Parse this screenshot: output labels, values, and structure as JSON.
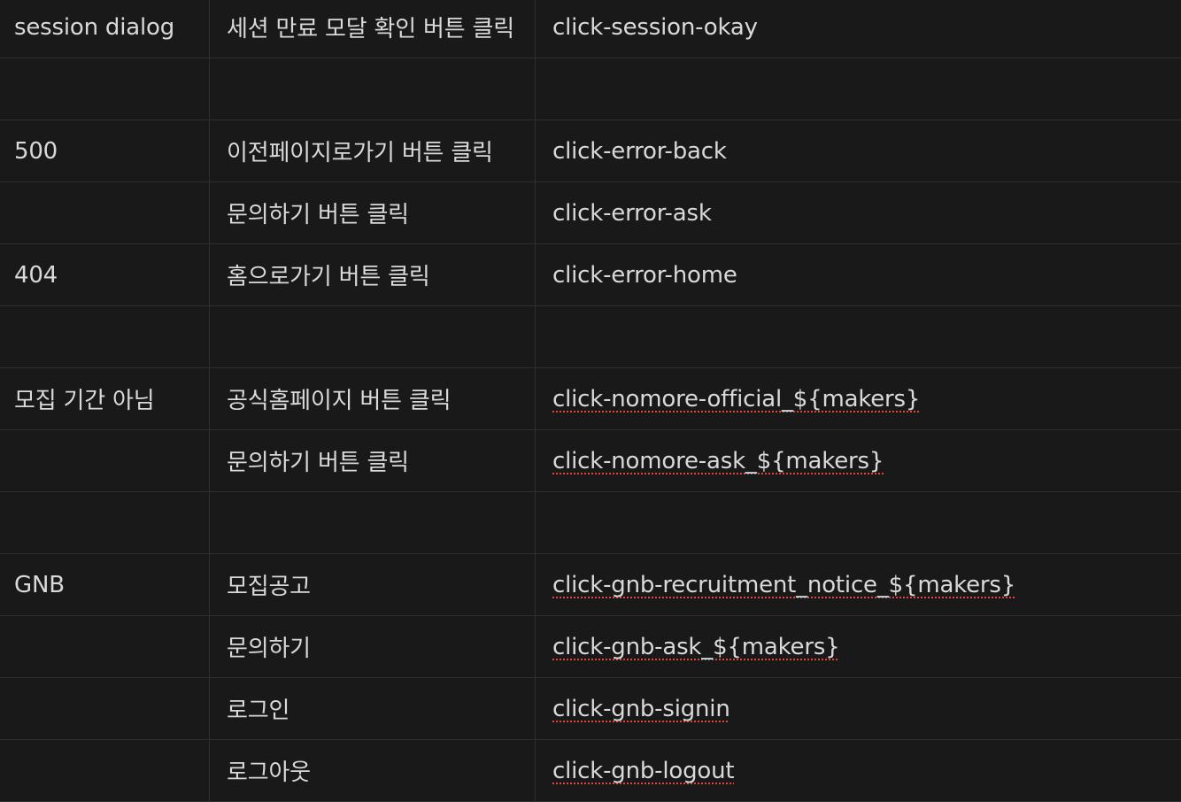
{
  "table": {
    "rows": [
      {
        "page": "session dialog",
        "action": "세션 만료 모달 확인 버튼 클릭",
        "event": "click-session-okay",
        "spell_underlined": false
      },
      {
        "page": "",
        "action": "",
        "event": "",
        "spell_underlined": false
      },
      {
        "page": "500",
        "action": "이전페이지로가기 버튼 클릭",
        "event": "click-error-back",
        "spell_underlined": false
      },
      {
        "page": "",
        "action": "문의하기 버튼 클릭",
        "event": "click-error-ask",
        "spell_underlined": false
      },
      {
        "page": "404",
        "action": "홈으로가기 버튼 클릭",
        "event": "click-error-home",
        "spell_underlined": false
      },
      {
        "page": "",
        "action": "",
        "event": "",
        "spell_underlined": false
      },
      {
        "page": "모집 기간 아님",
        "action": "공식홈페이지 버튼 클릭",
        "event": "click-nomore-official_${makers}",
        "spell_underlined": true
      },
      {
        "page": "",
        "action": "문의하기 버튼 클릭",
        "event": "click-nomore-ask_${makers}",
        "spell_underlined": true
      },
      {
        "page": "",
        "action": "",
        "event": "",
        "spell_underlined": false
      },
      {
        "page": "GNB",
        "action": "모집공고",
        "event": "click-gnb-recruitment_notice_${makers}",
        "spell_underlined": true
      },
      {
        "page": "",
        "action": "문의하기",
        "event": "click-gnb-ask_${makers}",
        "spell_underlined": true
      },
      {
        "page": "",
        "action": "로그인",
        "event": "click-gnb-signin",
        "spell_underlined": true
      },
      {
        "page": "",
        "action": "로그아웃",
        "event": "click-gnb-logout",
        "spell_underlined": true
      }
    ]
  },
  "colors": {
    "background": "#191919",
    "text": "#d9d9d9",
    "border": "#2f2f2f",
    "spellcheck": "#e0443e"
  }
}
